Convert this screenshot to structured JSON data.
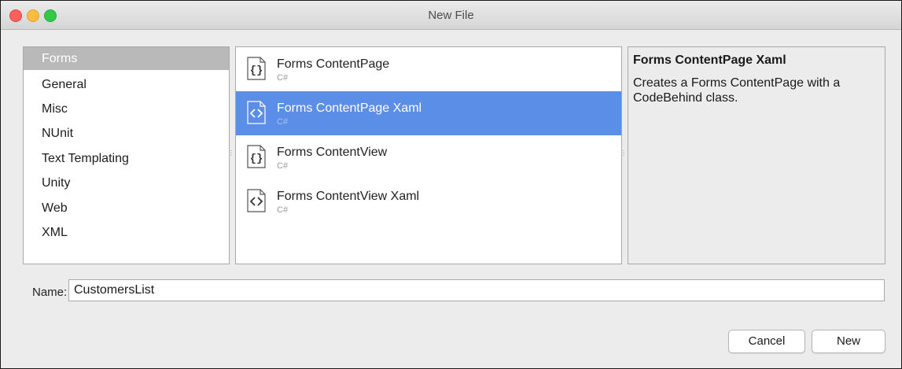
{
  "window": {
    "title": "New File"
  },
  "categories": {
    "items": [
      {
        "label": "Forms",
        "selected": true
      },
      {
        "label": "General",
        "selected": false
      },
      {
        "label": "Misc",
        "selected": false
      },
      {
        "label": "NUnit",
        "selected": false
      },
      {
        "label": "Text Templating",
        "selected": false
      },
      {
        "label": "Unity",
        "selected": false
      },
      {
        "label": "Web",
        "selected": false
      },
      {
        "label": "XML",
        "selected": false
      }
    ]
  },
  "templates": {
    "items": [
      {
        "name": "Forms ContentPage",
        "lang": "C#",
        "icon": "code-braces-icon",
        "selected": false
      },
      {
        "name": "Forms ContentPage Xaml",
        "lang": "C#",
        "icon": "code-angle-brackets-icon",
        "selected": true
      },
      {
        "name": "Forms ContentView",
        "lang": "C#",
        "icon": "code-braces-icon",
        "selected": false
      },
      {
        "name": "Forms ContentView Xaml",
        "lang": "C#",
        "icon": "code-angle-brackets-icon",
        "selected": false
      }
    ]
  },
  "description": {
    "title": "Forms ContentPage Xaml",
    "body": "Creates a Forms ContentPage with a CodeBehind class."
  },
  "name_field": {
    "label": "Name:",
    "value": "CustomersList"
  },
  "buttons": {
    "cancel": "Cancel",
    "new": "New"
  },
  "colors": {
    "selection": "#5b8ee6",
    "category_selection": "#b9b9b9"
  }
}
